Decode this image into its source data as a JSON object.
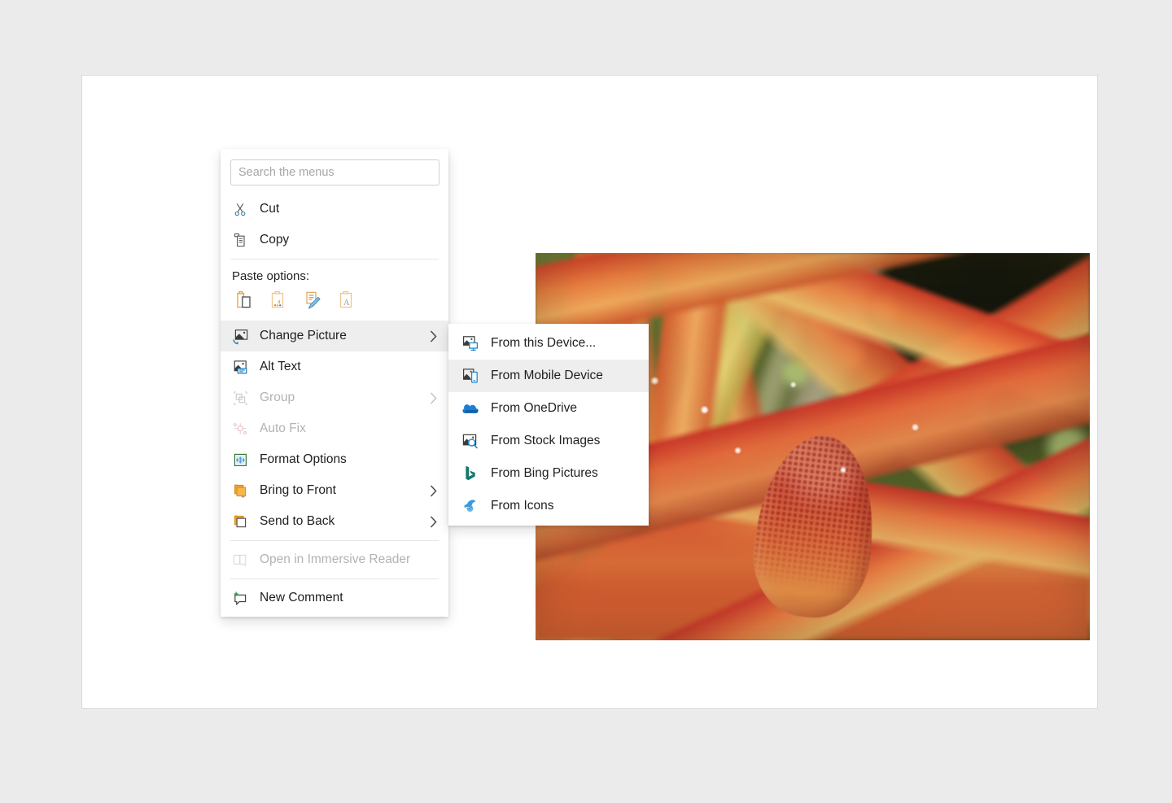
{
  "app": {
    "surface": "word-online-document-canvas",
    "background_color": "#ebebeb",
    "page_color": "#ffffff"
  },
  "document": {
    "picture": {
      "alt": "Close-up photograph of a red and orange tipped succulent plant with blurred green foliage background",
      "selected": true
    }
  },
  "context_menu": {
    "search": {
      "placeholder": "Search the menus",
      "value": ""
    },
    "items": [
      {
        "id": "cut",
        "label": "Cut",
        "icon": "scissors-icon",
        "enabled": true,
        "submenu": false
      },
      {
        "id": "copy",
        "label": "Copy",
        "icon": "copy-icon",
        "enabled": true,
        "submenu": false
      },
      {
        "id": "change-picture",
        "label": "Change Picture",
        "icon": "change-picture-icon",
        "enabled": true,
        "submenu": true,
        "highlighted": true
      },
      {
        "id": "alt-text",
        "label": "Alt Text",
        "icon": "alt-text-icon",
        "enabled": true,
        "submenu": false
      },
      {
        "id": "group",
        "label": "Group",
        "icon": "group-icon",
        "enabled": false,
        "submenu": true
      },
      {
        "id": "auto-fix",
        "label": "Auto Fix",
        "icon": "auto-fix-icon",
        "enabled": false,
        "submenu": false
      },
      {
        "id": "format-options",
        "label": "Format Options",
        "icon": "format-options-icon",
        "enabled": true,
        "submenu": false
      },
      {
        "id": "bring-to-front",
        "label": "Bring to Front",
        "icon": "bring-to-front-icon",
        "enabled": true,
        "submenu": true
      },
      {
        "id": "send-to-back",
        "label": "Send to Back",
        "icon": "send-to-back-icon",
        "enabled": true,
        "submenu": true
      },
      {
        "id": "immersive",
        "label": "Open in Immersive Reader",
        "icon": "immersive-reader-icon",
        "enabled": false,
        "submenu": false
      },
      {
        "id": "new-comment",
        "label": "New Comment",
        "icon": "new-comment-icon",
        "enabled": true,
        "submenu": false
      }
    ],
    "paste": {
      "header": "Paste options:",
      "options": [
        {
          "id": "keep-source-formatting",
          "icon": "paste-keep-source-icon"
        },
        {
          "id": "merge-formatting",
          "icon": "paste-merge-formatting-icon"
        },
        {
          "id": "picture",
          "icon": "paste-picture-icon"
        },
        {
          "id": "keep-text-only",
          "icon": "paste-keep-text-only-icon"
        }
      ]
    }
  },
  "submenu": {
    "parent": "Change Picture",
    "items": [
      {
        "id": "from-this-device",
        "label": "From this Device...",
        "icon": "from-device-icon",
        "highlighted": false
      },
      {
        "id": "from-mobile",
        "label": "From Mobile Device",
        "icon": "from-mobile-icon",
        "highlighted": true
      },
      {
        "id": "from-onedrive",
        "label": "From OneDrive",
        "icon": "onedrive-icon",
        "highlighted": false
      },
      {
        "id": "from-stock-images",
        "label": "From Stock Images",
        "icon": "stock-images-icon",
        "highlighted": false
      },
      {
        "id": "from-bing",
        "label": "From Bing Pictures",
        "icon": "bing-icon",
        "highlighted": false
      },
      {
        "id": "from-icons",
        "label": "From Icons",
        "icon": "icons-library-icon",
        "highlighted": false
      }
    ]
  },
  "colors": {
    "highlight": "#eeeeee",
    "text": "#201f1e",
    "disabled_text": "#b3b3b3",
    "separator": "#e6e6e6",
    "accent_blue": "#0078d4",
    "accent_orange": "#e8a33d",
    "accent_green": "#107c41",
    "bing_teal": "#0d7c6a"
  }
}
